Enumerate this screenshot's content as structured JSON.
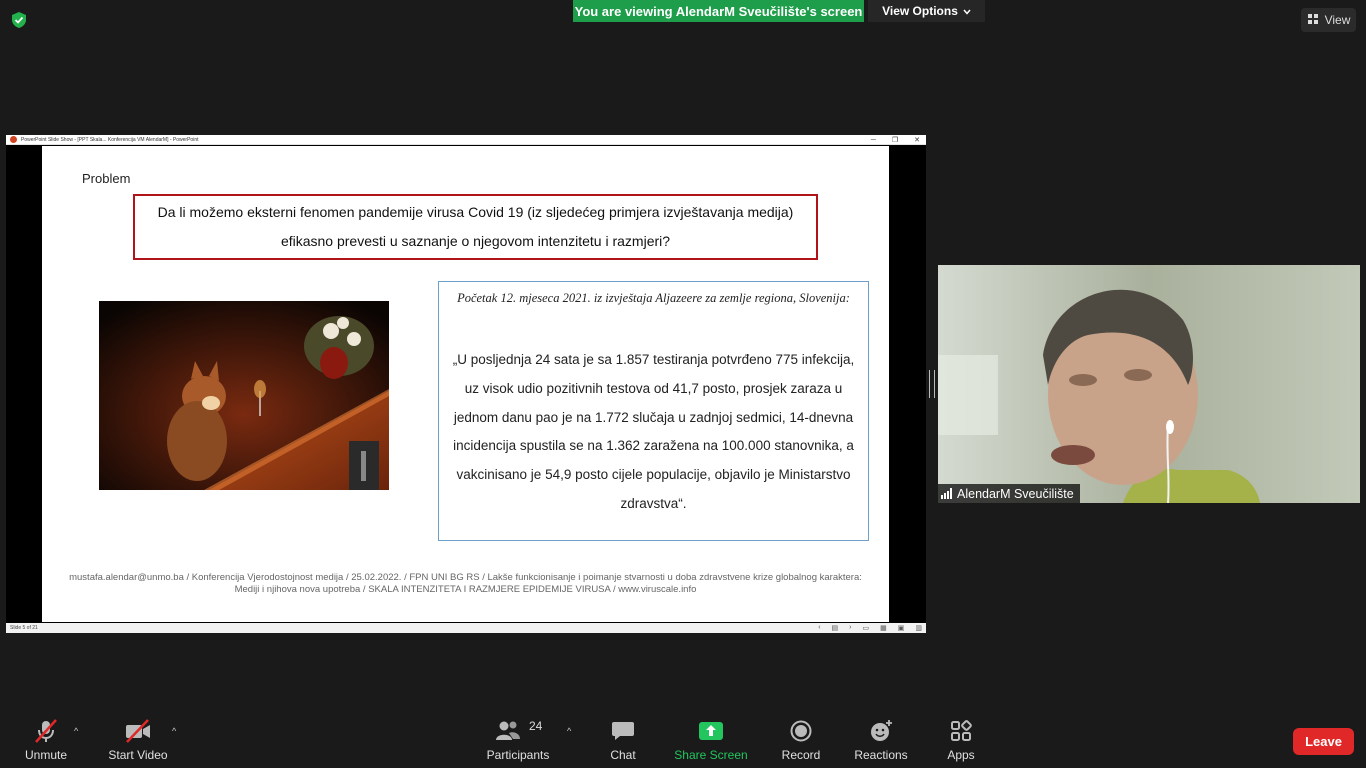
{
  "topbar": {
    "banner_text": "You are viewing AlendarM Sveučilište's screen",
    "view_options_label": "View Options",
    "view_label": "View"
  },
  "ppt": {
    "window_title": "PowerPoint Slide Show - [PPT Skala... Konferencija VM AlendarM] - PowerPoint",
    "status_text": "Slide 5 of 21"
  },
  "slide": {
    "heading": "Problem",
    "question": "Da li možemo eksterni fenomen pandemije virusa Covid 19 (iz sljedećeg primjera izvještavanja medija) efikasno prevesti u saznanje o njegovom intenzitetu i razmjeri?",
    "quote_source": "Početak 12. mjeseca 2021. iz izvještaja Aljazeere za zemlje regiona, Slovenija:",
    "quote_text": "„U posljednja 24 sata je sa 1.857 testiranja potvrđeno 775 infekcija, uz visok udio pozitivnih testova od 41,7 posto, prosjek zaraza u jednom danu pao je na 1.772 slučaja u zadnjoj sedmici, 14-dnevna incidencija spustila se na 1.362 zaražena na 100.000 stanovnika, a vakcinisano je 54,9 posto cijele populacije, objavilo je Ministarstvo zdravstva“.",
    "footer_line1": "mustafa.alendar@unmo.ba / Konferencija Vjerodostojnost medija / 25.02.2022. / FPN UNI BG RS / Lakše funkcionisanje i poimanje stvarnosti u doba zdravstvene krize globalnog karaktera:",
    "footer_line2": "Mediji i njihova nova upotreba / SKALA INTENZITETA I RAZMJERE EPIDEMIJE VIRUSA /  www.viruscale.info"
  },
  "video": {
    "participant_name": "AlendarM Sveučilište"
  },
  "toolbar": {
    "unmute_label": "Unmute",
    "start_video_label": "Start Video",
    "participants_label": "Participants",
    "participants_count": "24",
    "chat_label": "Chat",
    "share_screen_label": "Share Screen",
    "record_label": "Record",
    "reactions_label": "Reactions",
    "apps_label": "Apps",
    "leave_label": "Leave"
  },
  "colors": {
    "banner_green": "#1e9e4a",
    "leave_red": "#e02828",
    "share_green": "#22c55e",
    "question_border": "#b0141a"
  }
}
